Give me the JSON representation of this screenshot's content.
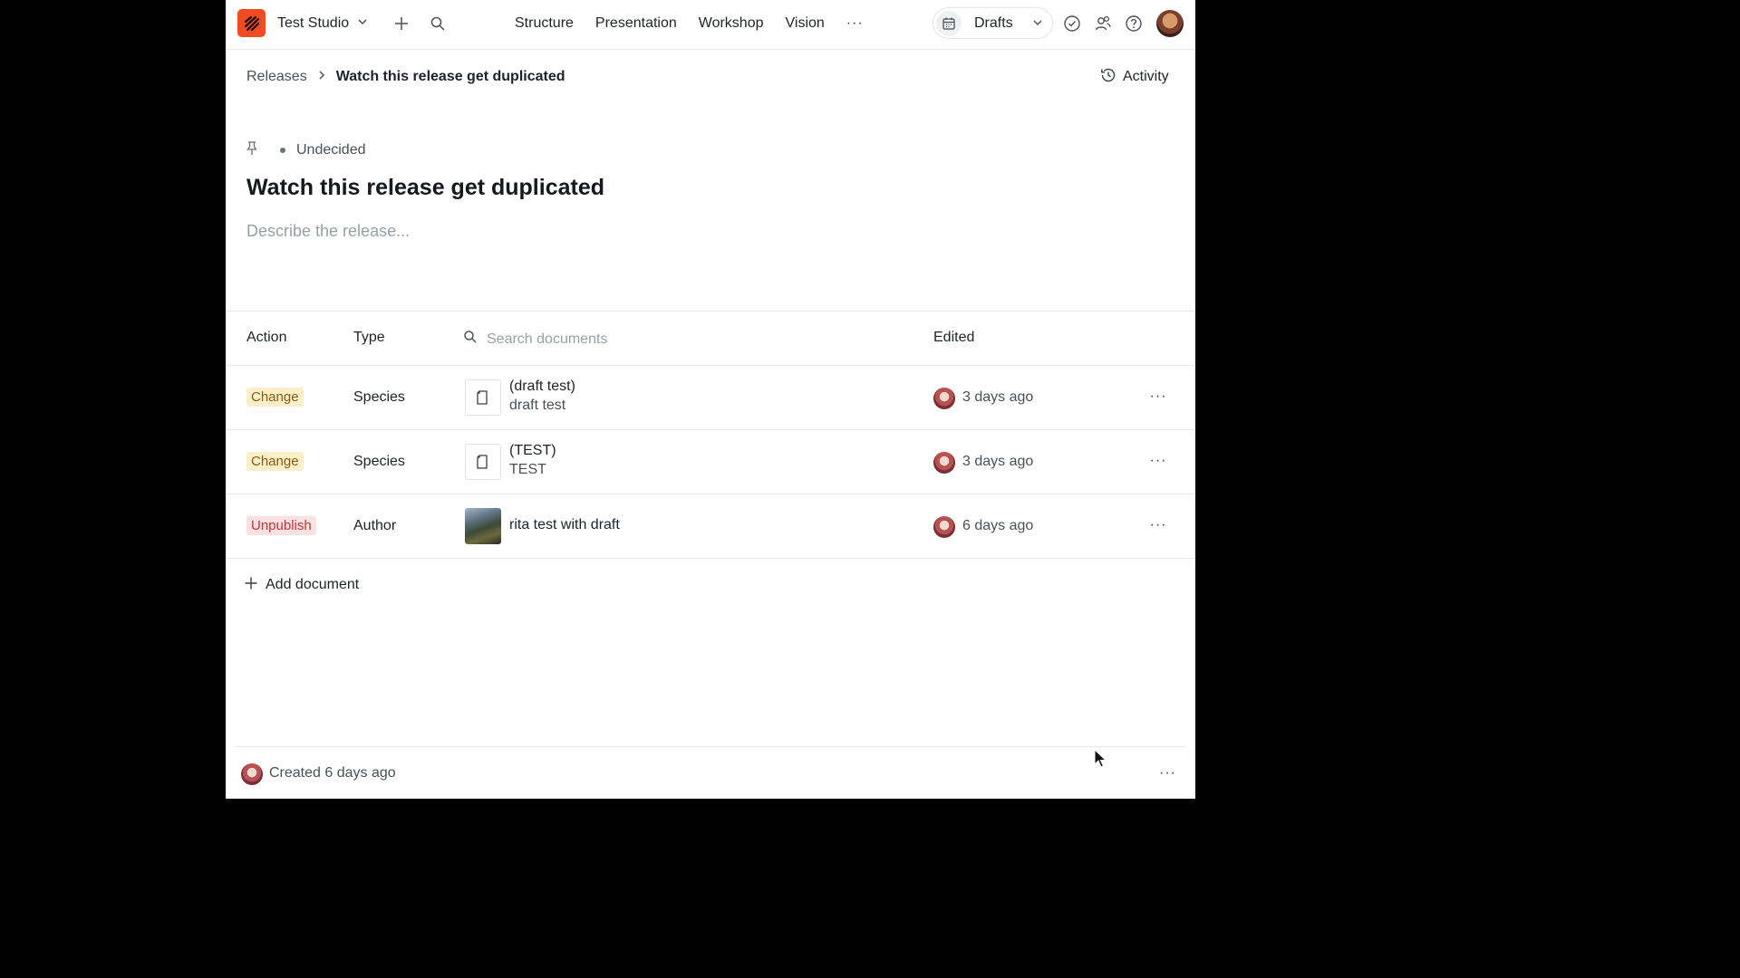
{
  "navbar": {
    "studio_name": "Test Studio",
    "links": [
      "Structure",
      "Presentation",
      "Workshop",
      "Vision"
    ],
    "more": "···",
    "perspective_label": "Drafts",
    "icons": [
      "logo-icon",
      "chevron-down-icon",
      "plus-icon",
      "search-icon",
      "calendar-icon",
      "check-circle-icon",
      "users-icon",
      "help-icon",
      "avatar"
    ]
  },
  "breadcrumb": {
    "parent": "Releases",
    "current": "Watch this release get duplicated"
  },
  "activity_label": "Activity",
  "release": {
    "status": "Undecided",
    "title": "Watch this release get duplicated",
    "description_placeholder": "Describe the release..."
  },
  "table": {
    "headers": {
      "action": "Action",
      "type": "Type",
      "search_placeholder": "Search documents",
      "edited": "Edited"
    },
    "rows": [
      {
        "action": "Change",
        "action_kind": "change",
        "type": "Species",
        "title": "(draft test)",
        "subtitle": "draft test",
        "edited": "3 days ago",
        "thumbnail": "document-icon"
      },
      {
        "action": "Change",
        "action_kind": "change",
        "type": "Species",
        "title": "(TEST)",
        "subtitle": "TEST",
        "edited": "3 days ago",
        "thumbnail": "document-icon"
      },
      {
        "action": "Unpublish",
        "action_kind": "unpublish",
        "type": "Author",
        "title": "rita test with draft",
        "subtitle": "",
        "edited": "6 days ago",
        "thumbnail": "landscape-image"
      }
    ],
    "row_menu": "···"
  },
  "add_document_label": "Add document",
  "footer": {
    "created": "Created 6 days ago",
    "menu": "···"
  },
  "colors": {
    "brand": "#f04b23",
    "change_badge_bg": "#fbefc9",
    "change_badge_text": "#8a5b12",
    "unpublish_badge_bg": "#fce1e1",
    "unpublish_badge_text": "#c0323a"
  }
}
